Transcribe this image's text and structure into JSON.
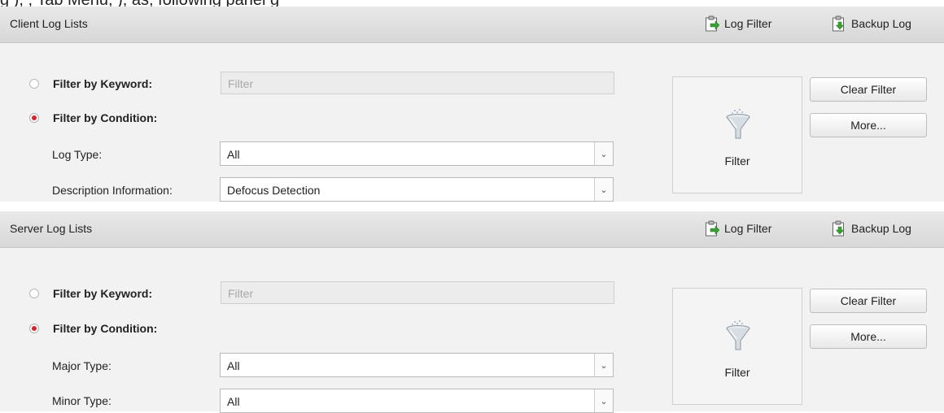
{
  "top_cut_text": "g                                    ), ,                                    Tab Menu,              ), as, following panel  g",
  "panels": [
    {
      "title": "Client Log Lists",
      "log_filter_label": "Log Filter",
      "backup_log_label": "Backup Log",
      "keyword": {
        "label": "Filter by Keyword:",
        "placeholder": "Filter",
        "selected": false
      },
      "condition": {
        "label": "Filter by Condition:",
        "selected": true
      },
      "fields": [
        {
          "label": "Log Type:",
          "value": "All"
        },
        {
          "label": "Description Information:",
          "value": "Defocus Detection"
        }
      ],
      "filter_button_label": "Filter",
      "clear_filter_label": "Clear Filter",
      "more_label": "More..."
    },
    {
      "title": "Server Log Lists",
      "log_filter_label": "Log Filter",
      "backup_log_label": "Backup Log",
      "keyword": {
        "label": "Filter by Keyword:",
        "placeholder": "Filter",
        "selected": false
      },
      "condition": {
        "label": "Filter by Condition:",
        "selected": true
      },
      "fields": [
        {
          "label": "Major Type:",
          "value": "All"
        },
        {
          "label": "Minor Type:",
          "value": "All"
        }
      ],
      "filter_button_label": "Filter",
      "clear_filter_label": "Clear Filter",
      "more_label": "More..."
    }
  ],
  "icons": {
    "log_filter": "clipboard-arrow-icon",
    "backup_log": "clipboard-save-icon",
    "filter": "funnel-icon",
    "dropdown": "chevron-down-icon"
  },
  "colors": {
    "radio_selected": "#d8232a",
    "panel_bg": "#f2f2f2",
    "header_bg": "#dedede",
    "arrow_green": "#3aa035"
  }
}
